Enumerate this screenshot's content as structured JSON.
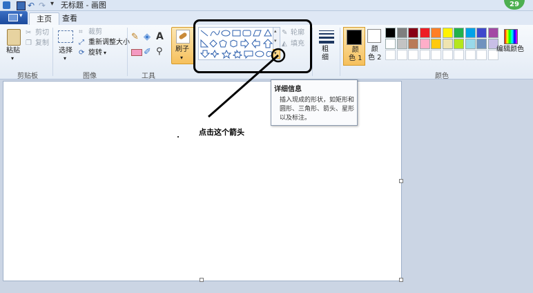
{
  "window": {
    "title": "无标题 - 画图"
  },
  "badge": "29",
  "tabs": [
    "主页",
    "查看"
  ],
  "groups": {
    "clipboard": {
      "label": "剪贴板",
      "paste": "粘贴",
      "cut": "剪切",
      "copy": "复制"
    },
    "image": {
      "label": "图像",
      "select": "选择",
      "crop": "裁剪",
      "resize": "重新调整大小",
      "rotate": "旋转"
    },
    "tools": {
      "label": "工具"
    },
    "brushes": {
      "label": "刷子"
    },
    "shapes": {
      "outline": "轮廓",
      "fill": "填充"
    },
    "size": {
      "label": "粗\n细"
    },
    "colors": {
      "label": "颜色",
      "color1": "颜\n色 1",
      "color2": "颜\n色 2",
      "edit": "编辑颜色"
    }
  },
  "tooltip": {
    "title": "详细信息",
    "body": "插入现成的形状，如矩形和圆形、三角形、箭头、星形以及标注。"
  },
  "annotation": {
    "text": "点击这个箭头"
  },
  "palette": {
    "row1": [
      "#000000",
      "#7f7f7f",
      "#880015",
      "#ed1c24",
      "#ff7f27",
      "#fff200",
      "#22b14c",
      "#00a2e8",
      "#3f48cc",
      "#a349a4"
    ],
    "row2": [
      "#ffffff",
      "#c3c3c3",
      "#b97a57",
      "#ffaec9",
      "#ffc90e",
      "#efe4b0",
      "#b5e61d",
      "#99d9ea",
      "#7092be",
      "#c8bfe7"
    ]
  },
  "colors": {
    "accent": "#f6c05c",
    "ribbon": "#e3ebf5",
    "annotation": "#000000"
  }
}
